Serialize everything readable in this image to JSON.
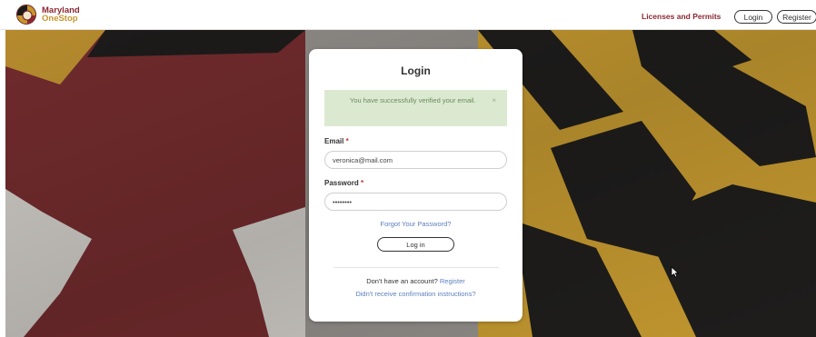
{
  "header": {
    "logo_line1": "Maryland",
    "logo_line2": "OneStop",
    "nav_link": "Licenses and Permits",
    "login_label": "Login",
    "register_label": "Register"
  },
  "colors": {
    "brand_maroon": "#8b2731",
    "brand_gold": "#c8952c",
    "alert_bg": "#dbe9d1",
    "link_blue": "#5b7fbd"
  },
  "card": {
    "title": "Login",
    "alert_message": "You have successfully verified your email.",
    "alert_close": "×",
    "email_label": "Email",
    "email_value": "veronica@mail.com",
    "password_label": "Password",
    "password_value": "••••••••",
    "required_mark": "*",
    "forgot_link": "Forgot Your Password?",
    "login_button": "Log in",
    "no_account_text": "Don't have an account?",
    "register_link": "Register",
    "confirmation_link": "Didn't receive confirmation instructions?"
  }
}
